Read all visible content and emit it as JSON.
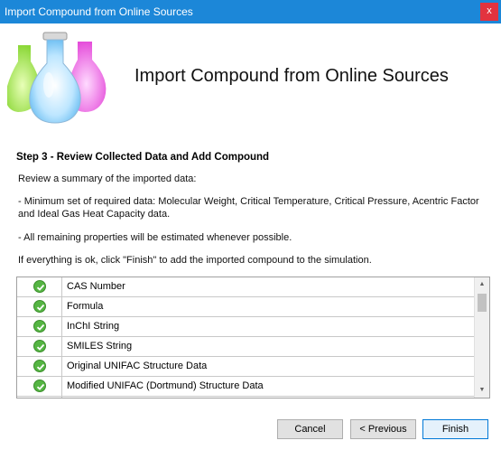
{
  "window": {
    "title": "Import Compound from Online Sources",
    "close_glyph": "x"
  },
  "header": {
    "title": "Import Compound from Online Sources",
    "icon": "chemistry-flasks-icon"
  },
  "step": {
    "heading": "Step 3 - Review Collected Data and Add Compound",
    "line1": "Review a summary of the imported data:",
    "line2": "- Minimum set of required data: Molecular Weight, Critical Temperature, Critical Pressure, Acentric Factor",
    "line3": "and Ideal Gas Heat Capacity data.",
    "line4": "- All remaining properties will be estimated whenever possible.",
    "line5": "If everything is ok, click \"Finish\" to add the imported compound to the simulation."
  },
  "summary_list": {
    "status_icon": "check-circle-icon",
    "status_color": "#55b543",
    "rows": [
      {
        "label": "CAS Number"
      },
      {
        "label": "Formula"
      },
      {
        "label": "InChI String"
      },
      {
        "label": "SMILES String"
      },
      {
        "label": "Original UNIFAC Structure Data"
      },
      {
        "label": "Modified UNIFAC (Dortmund) Structure Data"
      }
    ]
  },
  "buttons": {
    "cancel": "Cancel",
    "previous": "< Previous",
    "finish": "Finish"
  },
  "colors": {
    "titlebar": "#1c87d8",
    "close": "#e2333f"
  }
}
